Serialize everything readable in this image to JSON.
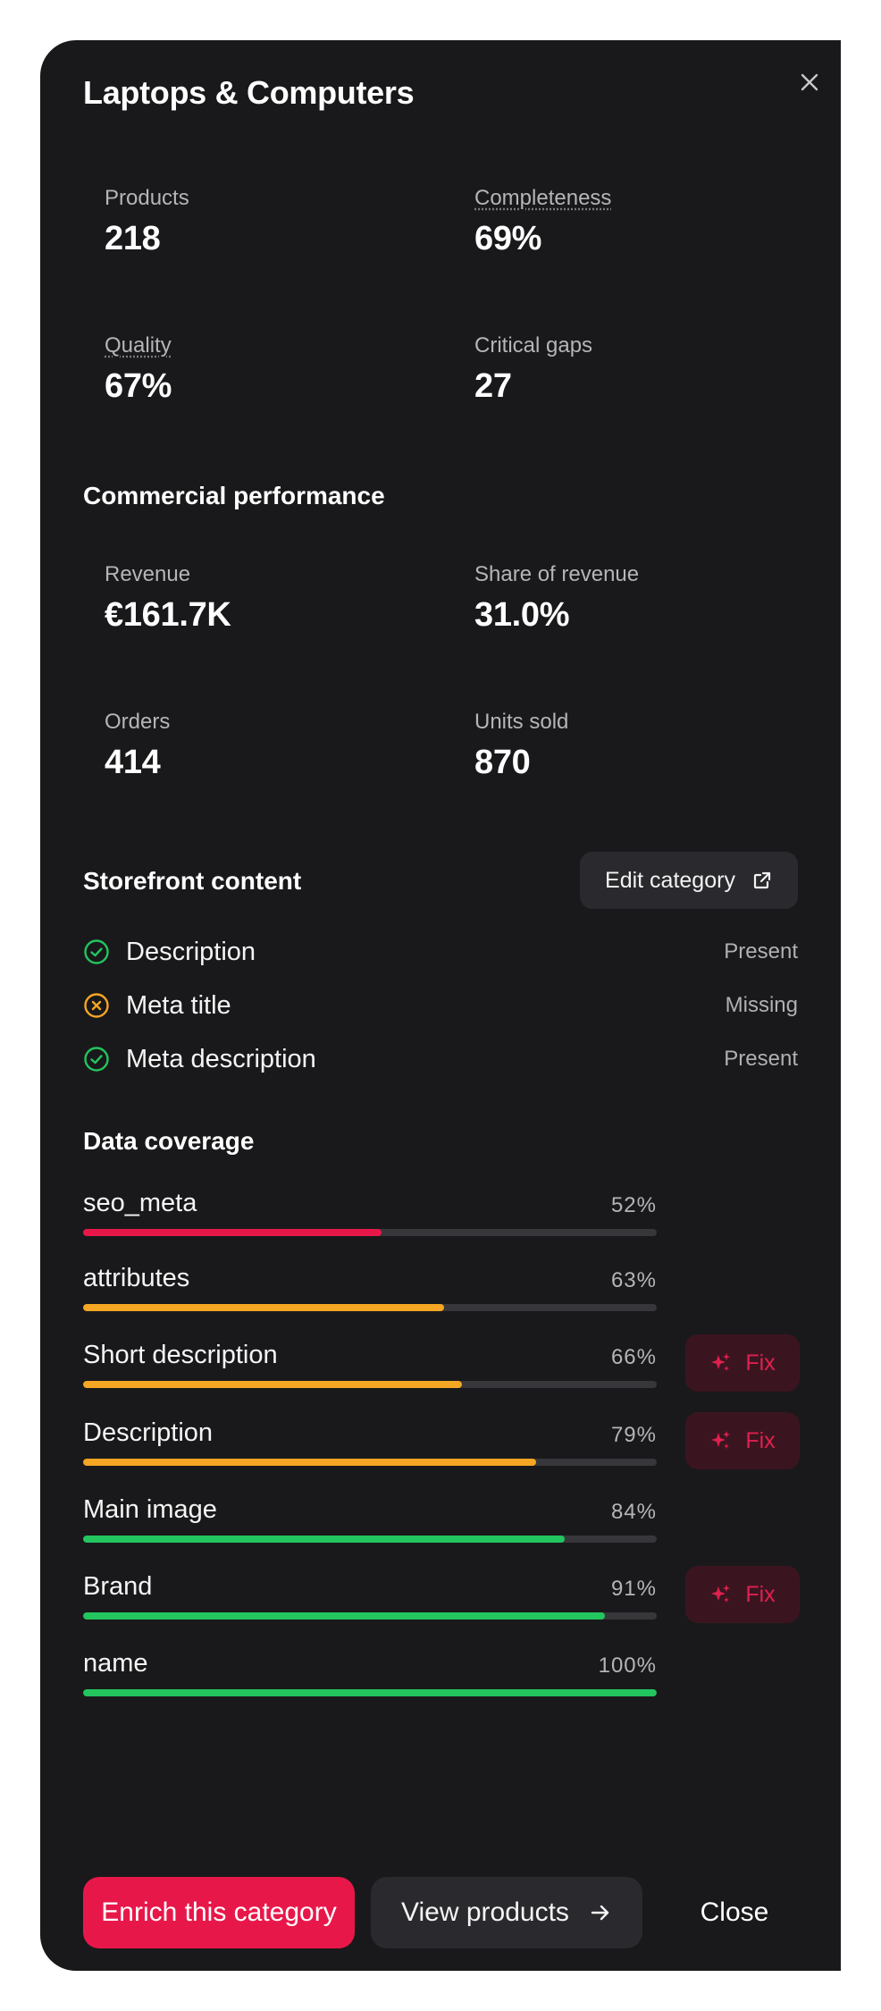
{
  "title": "Laptops & Computers",
  "stats": {
    "products": {
      "label": "Products",
      "value": "218"
    },
    "completeness": {
      "label": "Completeness",
      "value": "69%"
    },
    "quality": {
      "label": "Quality",
      "value": "67%"
    },
    "critical_gaps": {
      "label": "Critical gaps",
      "value": "27"
    }
  },
  "commercial": {
    "heading": "Commercial performance",
    "revenue": {
      "label": "Revenue",
      "value": "€161.7K"
    },
    "share": {
      "label": "Share of revenue",
      "value": "31.0%"
    },
    "orders": {
      "label": "Orders",
      "value": "414"
    },
    "units": {
      "label": "Units sold",
      "value": "870"
    }
  },
  "storefront": {
    "heading": "Storefront content",
    "edit_label": "Edit category",
    "items": [
      {
        "name": "Description",
        "status": "Present",
        "icon": "check-circle-icon"
      },
      {
        "name": "Meta title",
        "status": "Missing",
        "icon": "x-circle-icon"
      },
      {
        "name": "Meta description",
        "status": "Present",
        "icon": "check-circle-icon"
      }
    ]
  },
  "coverage": {
    "heading": "Data coverage",
    "fix_label": "Fix",
    "items": [
      {
        "name": "seo_meta",
        "pct": "52%",
        "value": 52,
        "color": "#e8174a",
        "fix": false
      },
      {
        "name": "attributes",
        "pct": "63%",
        "value": 63,
        "color": "#f5a623",
        "fix": false
      },
      {
        "name": "Short description",
        "pct": "66%",
        "value": 66,
        "color": "#f5a623",
        "fix": true
      },
      {
        "name": "Description",
        "pct": "79%",
        "value": 79,
        "color": "#f5a623",
        "fix": true
      },
      {
        "name": "Main image",
        "pct": "84%",
        "value": 84,
        "color": "#22c55e",
        "fix": false
      },
      {
        "name": "Brand",
        "pct": "91%",
        "value": 91,
        "color": "#22c55e",
        "fix": true
      },
      {
        "name": "name",
        "pct": "100%",
        "value": 100,
        "color": "#22c55e",
        "fix": false
      }
    ]
  },
  "footer": {
    "enrich_label": "Enrich this category",
    "view_label": "View products",
    "close_label": "Close"
  },
  "colors": {
    "accent": "#e8174a",
    "present": "#22c55e",
    "missing": "#f5a623"
  }
}
